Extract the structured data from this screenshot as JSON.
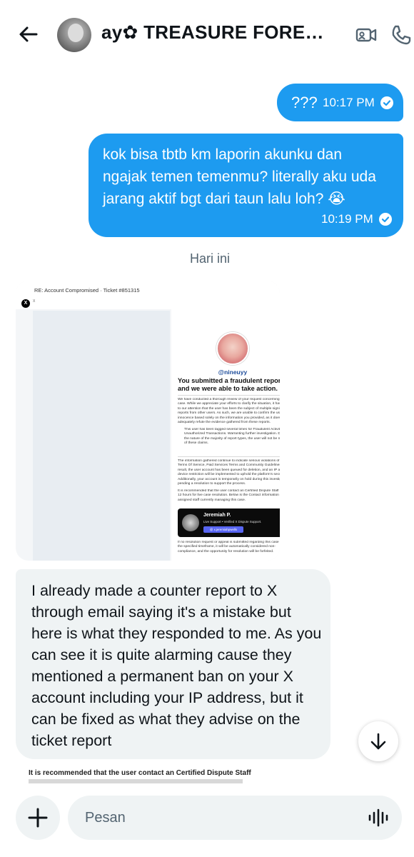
{
  "header": {
    "title": "ay✿ TREASURE FOREVE...",
    "back_icon": "arrow-left-icon",
    "video_icon": "video-call-icon",
    "call_icon": "phone-icon"
  },
  "messages": [
    {
      "direction": "out",
      "text": "???",
      "time": "10:17 PM",
      "status_icon": "read-check-icon"
    },
    {
      "direction": "out",
      "text": "kok bisa tbtb km laporin akunku dan ngajak temen temenmu? literally aku uda jarang aktif bgt dari taun lalu loh? 😭",
      "time": "10:19 PM",
      "status_icon": "read-check-icon"
    }
  ],
  "day_divider": "Hari ini",
  "attachment": {
    "subject": "RE: Account Compromised · Ticket #851315",
    "sender": "X",
    "handle": "@nineuyy",
    "heading": "You submitted a fraudulent report and we were able to take action.",
    "paragraph1": "We have conducted a thorough review of your request concerning this case. While we appreciate your efforts to clarify the situation, it has come to our attention that the user has been the subject of multiple significant reports from other users. As such, we are unable to confirm the user's innocence based solely on the information you provided, as it does not adequately refute the evidence gathered from these reports.",
    "bullet": "This user has been tagged several times for Fraudulent Activity and Unauthorized Transactions. Warranting further investigation. Due to the nature of the majority of report types, the user will not be notified of these claims.",
    "paragraph2": "The information gathered continue to indicate serious violations of our Terms Of Service, Paid Services Terms and Community Guidelines. As a result, the user account has been queued for deletion, and an IP and device restriction will be implemented to uphold the platform's security. Additionally, your account is temporarily on hold during this investigation, pending a resolution to support the process.",
    "paragraph3": "It is recommended that the user contact an Certified Dispute Staff within 12 hours for live case resolution. Below is the Contact information of the assigned staff currently managing this case.",
    "staff_name": "Jeremiah P.",
    "staff_role": "Live Support • Verified X Dispute Support.",
    "staff_contact": "@ x.jeremiahpwells",
    "warning": "If no resolution request or appeal is submitted regarding this case within the specified timeframe, it will be automatically considered non-compliance, and the opportunity for resolution will be forfeited."
  },
  "incoming": {
    "text": "I already made a counter report to X through email saying it's a mistake but here is what they responded to me. As you can see it is quite alarming cause they mentioned a permanent ban on your X account including your IP address, but it can be fixed as what they advise on the ticket report"
  },
  "peek_text": "It is recommended that the user contact an Certified Dispute Staff",
  "composer": {
    "placeholder": "Pesan",
    "add_icon": "plus-icon",
    "voice_icon": "voice-wave-icon"
  },
  "scroll_icon": "arrow-down-icon",
  "colors": {
    "accent": "#1d9bf0",
    "incoming_bg": "#eff3f4",
    "muted": "#536471"
  }
}
